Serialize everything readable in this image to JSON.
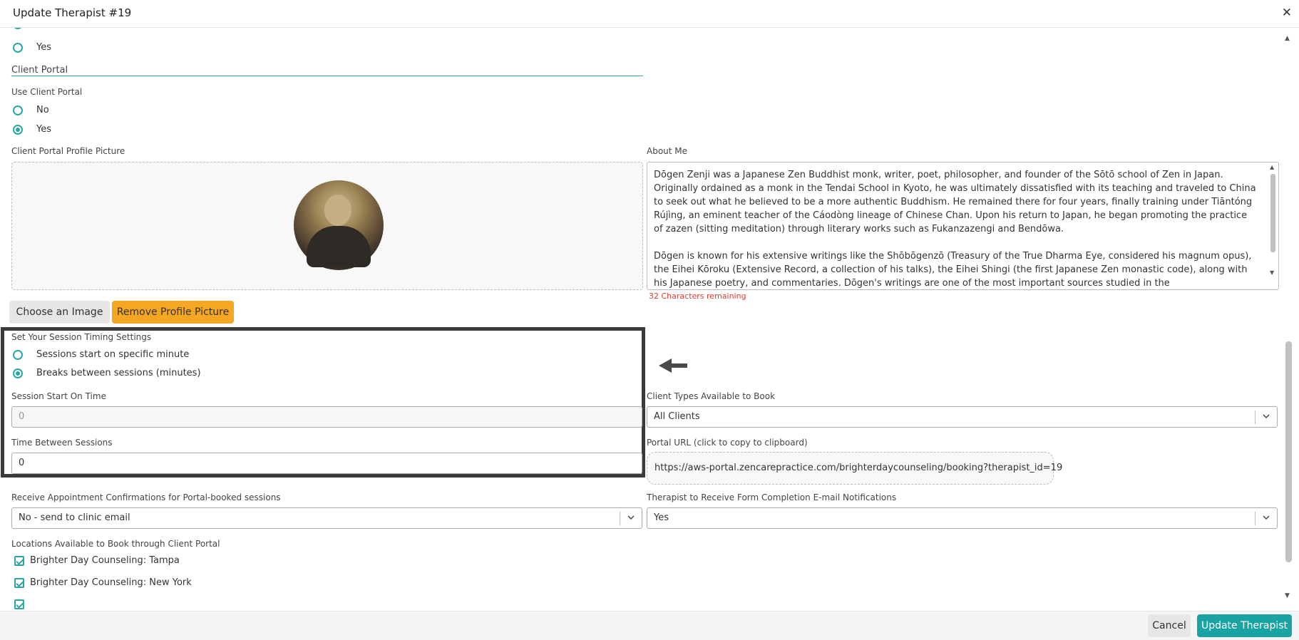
{
  "window": {
    "title": "Update Therapist #19",
    "close_icon": "close-icon"
  },
  "previous_option": {
    "label": "Yes",
    "selected": false
  },
  "client_portal": {
    "section_title": "Client Portal",
    "use_label": "Use Client Portal",
    "options": [
      {
        "label": "No",
        "selected": false
      },
      {
        "label": "Yes",
        "selected": true
      }
    ]
  },
  "profile_picture": {
    "label": "Client Portal Profile Picture",
    "choose_button": "Choose an Image",
    "remove_button": "Remove Profile Picture"
  },
  "about_me": {
    "label": "About Me",
    "text": "Dōgen Zenji was a Japanese Zen Buddhist monk, writer, poet, philosopher, and founder of the Sōtō school of Zen in Japan. Originally ordained as a monk in the Tendai School in Kyoto, he was ultimately dissatisfied with its teaching and traveled to China to seek out what he believed to be a more authentic Buddhism. He remained there for four years, finally training under Tiāntóng Rújìng, an eminent teacher of the Cáodòng lineage of Chinese Chan. Upon his return to Japan, he began promoting the practice of zazen (sitting meditation) through literary works such as Fukanzazengi and Bendōwa.\n\nDōgen is known for his extensive writings like the Shōbōgenzō (Treasury of the True Dharma Eye, considered his magnum opus), the Eihei Kōroku (Extensive Record, a collection of his talks), the Eihei Shingi (the first Japanese Zen monastic code), along with his Japanese poetry, and commentaries. Dōgen's writings are one of the most important sources studied in the",
    "chars_remaining": "32 Characters remaining"
  },
  "session_timing": {
    "label": "Set Your Session Timing Settings",
    "options": [
      {
        "label": "Sessions start on specific minute",
        "selected": false
      },
      {
        "label": "Breaks between sessions (minutes)",
        "selected": true
      }
    ],
    "start_label": "Session Start On Time",
    "start_value": "0",
    "between_label": "Time Between Sessions",
    "between_value": "0"
  },
  "client_types": {
    "label": "Client Types Available to Book",
    "value": "All Clients"
  },
  "portal_url": {
    "label": "Portal URL (click to copy to clipboard)",
    "value": "https://aws-portal.zencarepractice.com/brighterdaycounseling/booking?therapist_id=19"
  },
  "appointment_confirmations": {
    "label": "Receive Appointment Confirmations for Portal-booked sessions",
    "value": "No - send to clinic email"
  },
  "form_notifications": {
    "label": "Therapist to Receive Form Completion E-mail Notifications",
    "value": "Yes"
  },
  "locations": {
    "label": "Locations Available to Book through Client Portal",
    "items": [
      {
        "label": "Brighter Day Counseling: Tampa",
        "checked": true
      },
      {
        "label": "Brighter Day Counseling: New York",
        "checked": true
      }
    ]
  },
  "footer": {
    "cancel": "Cancel",
    "submit": "Update Therapist"
  },
  "colors": {
    "accent": "#2aa6a6",
    "orange": "#f5a623",
    "teal_button": "#1aa3a3",
    "error": "#e03b2e"
  }
}
